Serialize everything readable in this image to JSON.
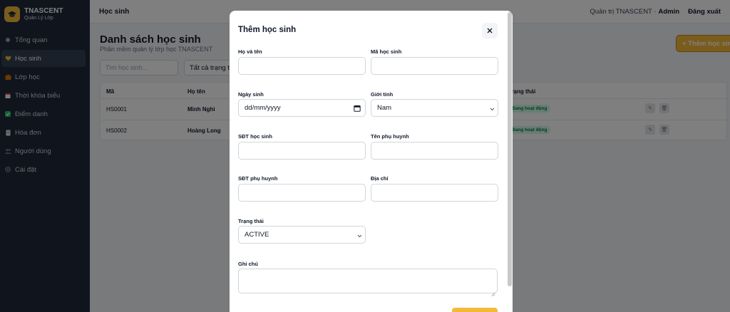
{
  "brand": {
    "title": "TNASCENT",
    "subtitle": "Quản Lý Lớp"
  },
  "sidebar": {
    "items": [
      {
        "label": "Tổng quan",
        "icon": "dot-icon"
      },
      {
        "label": "Học sinh",
        "icon": "heart-icon",
        "active": true
      },
      {
        "label": "Lớp học",
        "icon": "school-icon"
      },
      {
        "label": "Thời khóa biểu",
        "icon": "calendar-icon"
      },
      {
        "label": "Điểm danh",
        "icon": "check-icon"
      },
      {
        "label": "Hóa đơn",
        "icon": "invoice-icon"
      },
      {
        "label": "Người dùng",
        "icon": "users-icon"
      },
      {
        "label": "Cài đặt",
        "icon": "gear-icon"
      }
    ]
  },
  "topbar": {
    "title": "Học sinh",
    "role": "Quản trị TNASCENT ·",
    "user": "Admin",
    "logout": "Đăng xuất"
  },
  "page": {
    "title": "Danh sách học sinh",
    "subtitle": "Phần mềm quản lý lớp học TNASCENT",
    "add_button": "+ Thêm học sinh",
    "search_placeholder": "Tìm học sinh...",
    "status_filter": "Tất cả trạng thái"
  },
  "table": {
    "headers": {
      "code": "Mã",
      "name": "Họ tên",
      "status": "Trạng thái"
    },
    "rows": [
      {
        "code": "HS0001",
        "name": "Minh Nghi",
        "status": "Đang hoạt động"
      },
      {
        "code": "HS0002",
        "name": "Hoàng Long",
        "status": "Đang hoạt động"
      }
    ]
  },
  "modal": {
    "title": "Thêm học sinh",
    "fields": {
      "full_name": {
        "label": "Họ và tên",
        "value": ""
      },
      "student_code": {
        "label": "Mã học sinh",
        "value": ""
      },
      "dob": {
        "label": "Ngày sinh",
        "value": "dd/mm/yyyy"
      },
      "gender": {
        "label": "Giới tính",
        "value": "Nam"
      },
      "student_phone": {
        "label": "SĐT học sinh",
        "value": ""
      },
      "parent_name": {
        "label": "Tên phụ huynh",
        "value": ""
      },
      "parent_phone": {
        "label": "SĐT phụ huynh",
        "value": ""
      },
      "address": {
        "label": "Địa chỉ",
        "value": ""
      },
      "status": {
        "label": "Trạng thái",
        "value": "ACTIVE"
      },
      "note": {
        "label": "Ghi chú",
        "value": ""
      }
    }
  },
  "colors": {
    "accent": "#f5b93a",
    "sidebar": "#1e293b",
    "badge_bg": "#d1fae5",
    "badge_text": "#047857"
  }
}
